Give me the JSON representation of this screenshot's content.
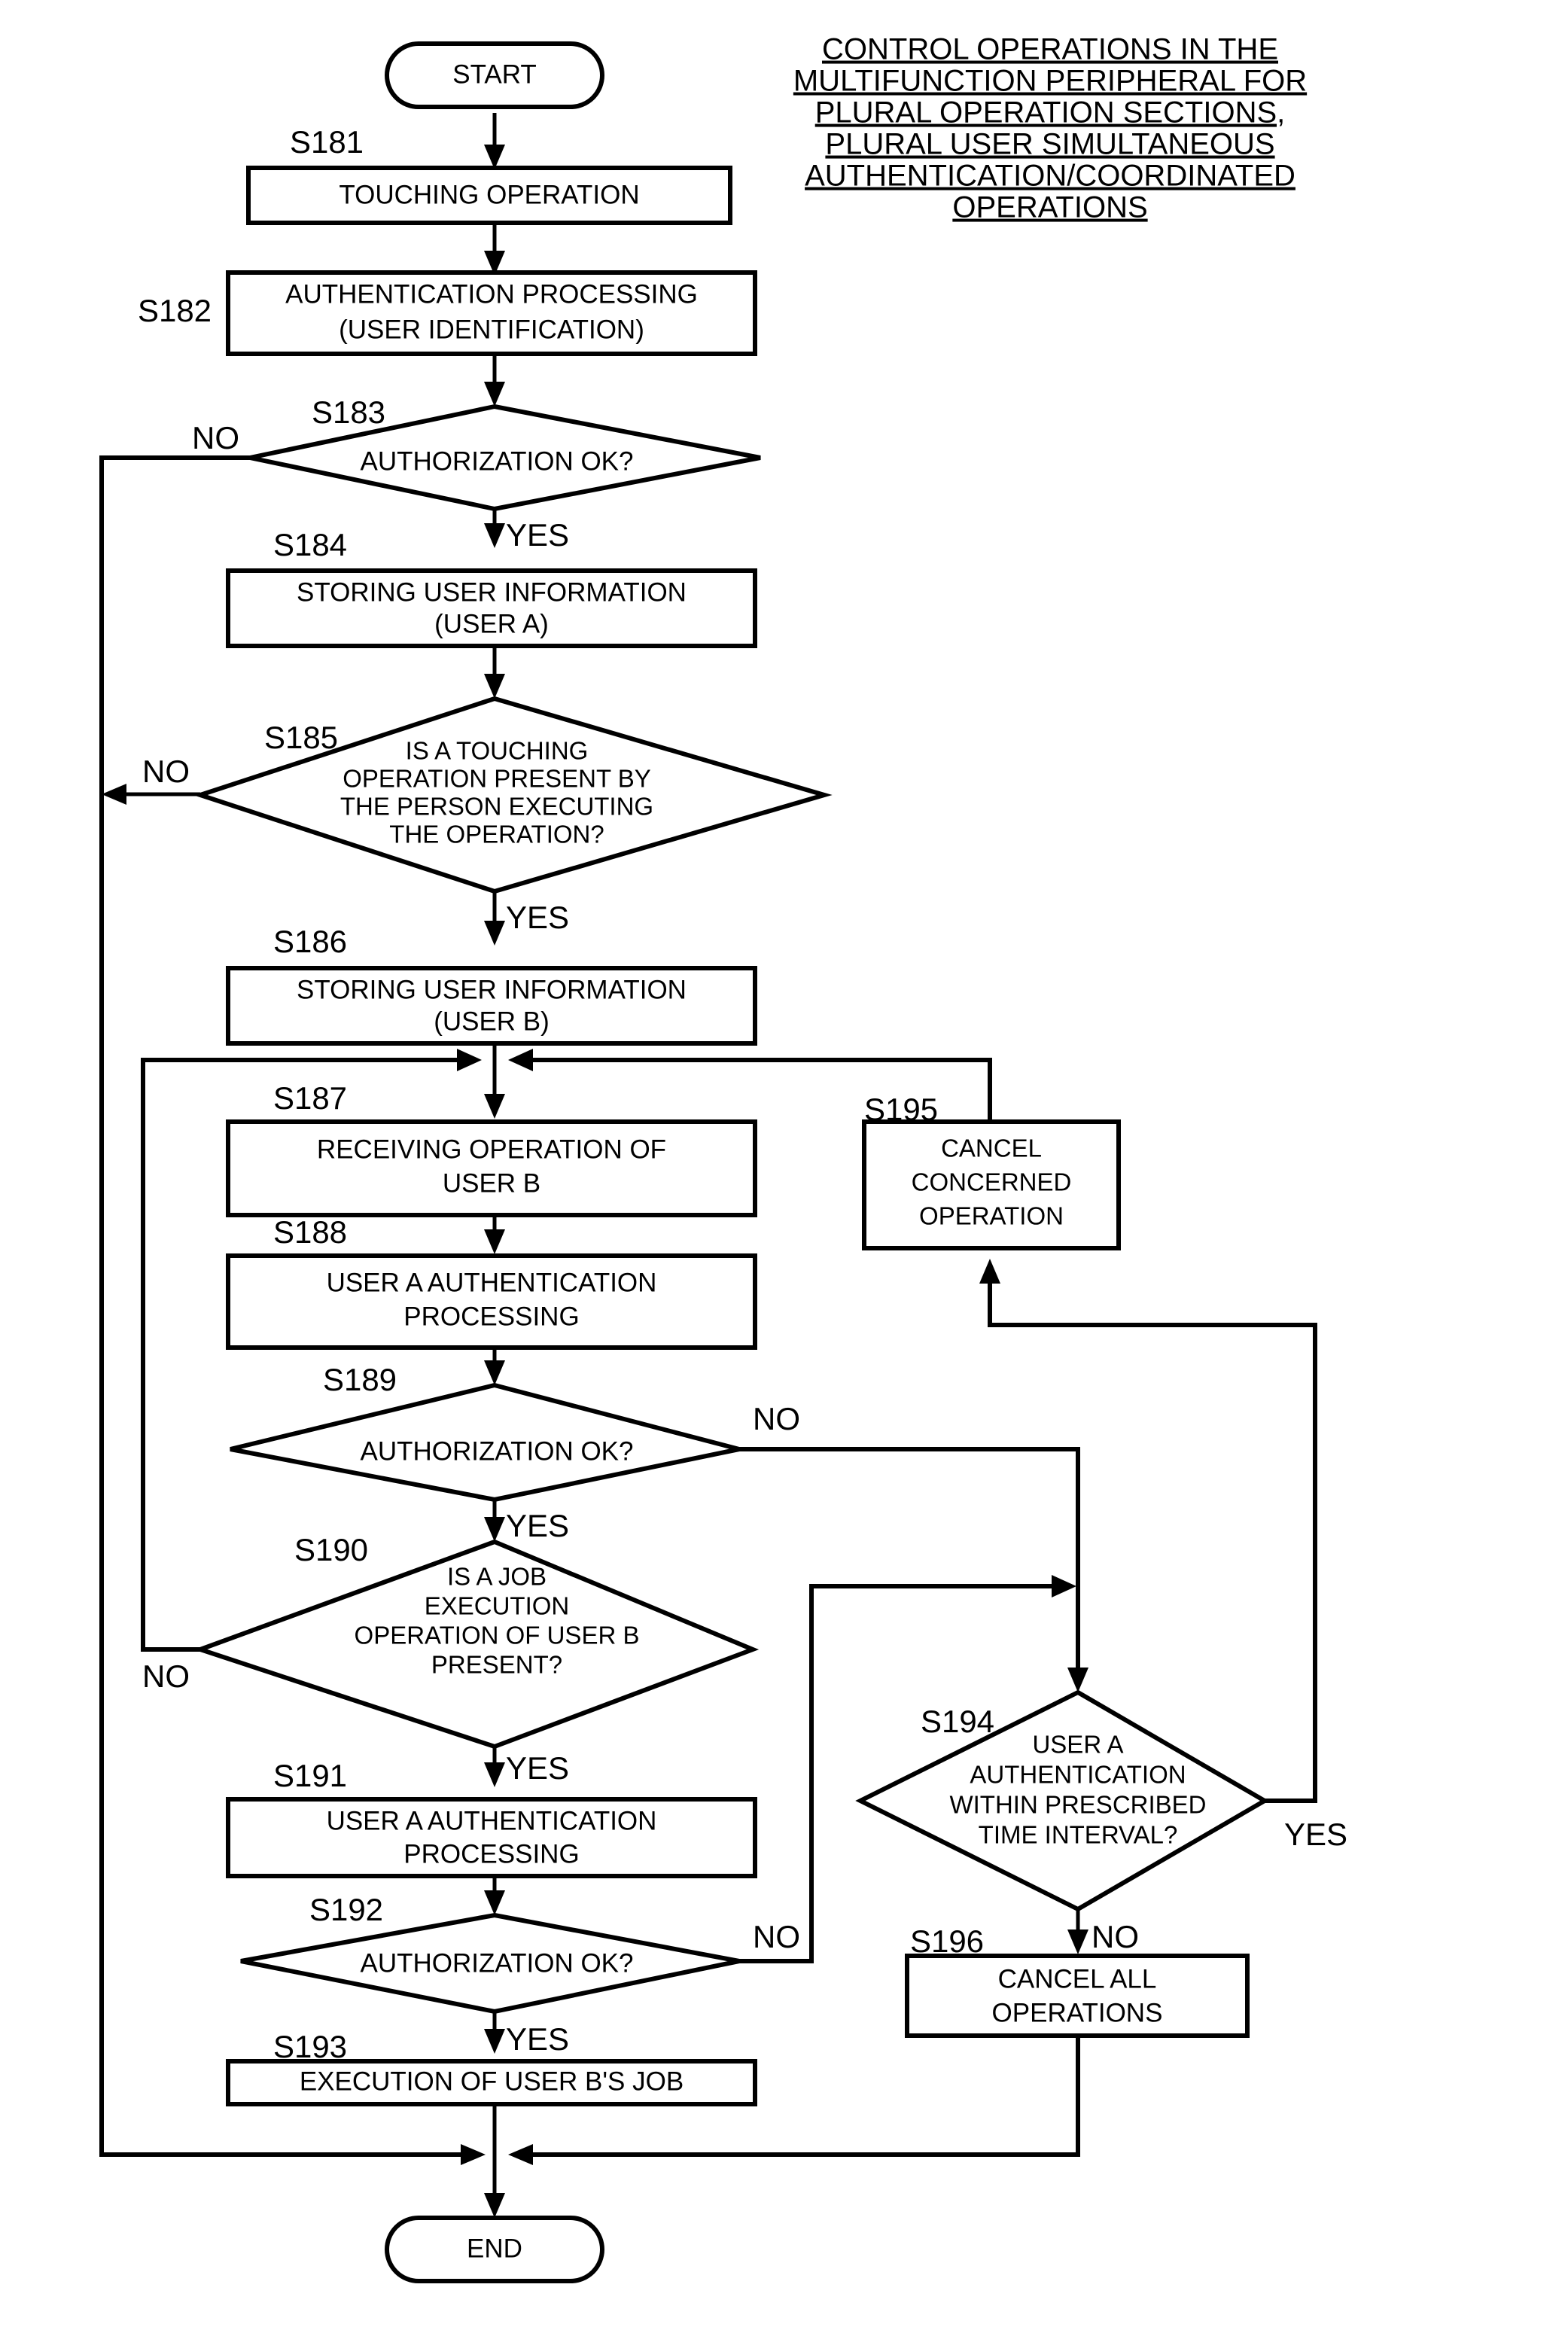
{
  "figure": {
    "title_lines": [
      "CONTROL OPERATIONS IN THE",
      "MULTIFUNCTION PERIPHERAL FOR",
      "PLURAL OPERATION SECTIONS,",
      "PLURAL USER SIMULTANEOUS",
      "AUTHENTICATION/COORDINATED",
      "OPERATIONS"
    ],
    "colors": {
      "stroke": "#000000",
      "fill": "#ffffff",
      "background": "#ffffff"
    }
  },
  "chart_data": {
    "type": "diagram",
    "diagram_type": "flowchart",
    "title": "CONTROL OPERATIONS IN THE MULTIFUNCTION PERIPHERAL FOR PLURAL OPERATION SECTIONS, PLURAL USER SIMULTANEOUS AUTHENTICATION/COORDINATED OPERATIONS",
    "nodes": [
      {
        "id": "start",
        "step": "",
        "shape": "terminator",
        "text": [
          "START"
        ]
      },
      {
        "id": "s181",
        "step": "S181",
        "shape": "process",
        "text": [
          "TOUCHING OPERATION"
        ]
      },
      {
        "id": "s182",
        "step": "S182",
        "shape": "process",
        "text": [
          "AUTHENTICATION PROCESSING",
          "(USER IDENTIFICATION)"
        ]
      },
      {
        "id": "s183",
        "step": "S183",
        "shape": "decision",
        "text": [
          "AUTHORIZATION OK?"
        ]
      },
      {
        "id": "s184",
        "step": "S184",
        "shape": "process",
        "text": [
          "STORING USER INFORMATION",
          "(USER A)"
        ]
      },
      {
        "id": "s185",
        "step": "S185",
        "shape": "decision",
        "text": [
          "IS A TOUCHING",
          "OPERATION PRESENT BY",
          "THE PERSON EXECUTING",
          "THE OPERATION?"
        ]
      },
      {
        "id": "s186",
        "step": "S186",
        "shape": "process",
        "text": [
          "STORING USER INFORMATION",
          "(USER B)"
        ]
      },
      {
        "id": "s187",
        "step": "S187",
        "shape": "process",
        "text": [
          "RECEIVING OPERATION OF",
          "USER B"
        ]
      },
      {
        "id": "s188",
        "step": "S188",
        "shape": "process",
        "text": [
          "USER A AUTHENTICATION",
          "PROCESSING"
        ]
      },
      {
        "id": "s189",
        "step": "S189",
        "shape": "decision",
        "text": [
          "AUTHORIZATION OK?"
        ]
      },
      {
        "id": "s190",
        "step": "S190",
        "shape": "decision",
        "text": [
          "IS A JOB",
          "EXECUTION",
          "OPERATION OF USER B",
          "PRESENT?"
        ]
      },
      {
        "id": "s191",
        "step": "S191",
        "shape": "process",
        "text": [
          "USER A AUTHENTICATION",
          "PROCESSING"
        ]
      },
      {
        "id": "s192",
        "step": "S192",
        "shape": "decision",
        "text": [
          "AUTHORIZATION OK?"
        ]
      },
      {
        "id": "s193",
        "step": "S193",
        "shape": "process",
        "text": [
          "EXECUTION OF USER B'S JOB"
        ]
      },
      {
        "id": "s194",
        "step": "S194",
        "shape": "decision",
        "text": [
          "USER A",
          "AUTHENTICATION",
          "WITHIN PRESCRIBED",
          "TIME INTERVAL?"
        ]
      },
      {
        "id": "s195",
        "step": "S195",
        "shape": "process",
        "text": [
          "CANCEL",
          "CONCERNED",
          "OPERATION"
        ]
      },
      {
        "id": "s196",
        "step": "S196",
        "shape": "process",
        "text": [
          "CANCEL ALL",
          "OPERATIONS"
        ]
      },
      {
        "id": "end",
        "step": "",
        "shape": "terminator",
        "text": [
          "END"
        ]
      }
    ],
    "edges": [
      {
        "from": "start",
        "to": "s181",
        "label": ""
      },
      {
        "from": "s181",
        "to": "s182",
        "label": ""
      },
      {
        "from": "s182",
        "to": "s183",
        "label": ""
      },
      {
        "from": "s183",
        "to": "end",
        "label": "NO"
      },
      {
        "from": "s183",
        "to": "s184",
        "label": "YES"
      },
      {
        "from": "s184",
        "to": "s185",
        "label": ""
      },
      {
        "from": "s185",
        "to": "end",
        "label": "NO"
      },
      {
        "from": "s185",
        "to": "s186",
        "label": "YES"
      },
      {
        "from": "s186",
        "to": "s187",
        "label": ""
      },
      {
        "from": "s187",
        "to": "s188",
        "label": ""
      },
      {
        "from": "s188",
        "to": "s189",
        "label": ""
      },
      {
        "from": "s189",
        "to": "s194",
        "label": "NO"
      },
      {
        "from": "s189",
        "to": "s190",
        "label": "YES"
      },
      {
        "from": "s190",
        "to": "s187",
        "label": "NO"
      },
      {
        "from": "s190",
        "to": "s191",
        "label": "YES"
      },
      {
        "from": "s191",
        "to": "s192",
        "label": ""
      },
      {
        "from": "s192",
        "to": "s194",
        "label": "NO"
      },
      {
        "from": "s192",
        "to": "s193",
        "label": "YES"
      },
      {
        "from": "s193",
        "to": "end",
        "label": ""
      },
      {
        "from": "s194",
        "to": "s195",
        "label": "YES"
      },
      {
        "from": "s194",
        "to": "s196",
        "label": "NO"
      },
      {
        "from": "s195",
        "to": "s187",
        "label": ""
      },
      {
        "from": "s196",
        "to": "end",
        "label": ""
      }
    ],
    "edge_labels": [
      "YES",
      "NO"
    ]
  },
  "nodes": {
    "start": {
      "step": "",
      "l1": "START",
      "l2": "",
      "l3": "",
      "l4": ""
    },
    "s181": {
      "step": "S181",
      "l1": "TOUCHING OPERATION",
      "l2": "",
      "l3": "",
      "l4": ""
    },
    "s182": {
      "step": "S182",
      "l1": "AUTHENTICATION PROCESSING",
      "l2": "(USER IDENTIFICATION)",
      "l3": "",
      "l4": ""
    },
    "s183": {
      "step": "S183",
      "l1": "AUTHORIZATION OK?",
      "l2": "",
      "l3": "",
      "l4": ""
    },
    "s184": {
      "step": "S184",
      "l1": "STORING USER INFORMATION",
      "l2": "(USER A)",
      "l3": "",
      "l4": ""
    },
    "s185": {
      "step": "S185",
      "l1": "IS A TOUCHING",
      "l2": "OPERATION PRESENT BY",
      "l3": "THE PERSON EXECUTING",
      "l4": "THE OPERATION?"
    },
    "s186": {
      "step": "S186",
      "l1": "STORING USER INFORMATION",
      "l2": "(USER B)",
      "l3": "",
      "l4": ""
    },
    "s187": {
      "step": "S187",
      "l1": "RECEIVING OPERATION OF",
      "l2": "USER B",
      "l3": "",
      "l4": ""
    },
    "s188": {
      "step": "S188",
      "l1": "USER A AUTHENTICATION",
      "l2": "PROCESSING",
      "l3": "",
      "l4": ""
    },
    "s189": {
      "step": "S189",
      "l1": "AUTHORIZATION OK?",
      "l2": "",
      "l3": "",
      "l4": ""
    },
    "s190": {
      "step": "S190",
      "l1": "IS A JOB",
      "l2": "EXECUTION",
      "l3": "OPERATION OF USER B",
      "l4": "PRESENT?"
    },
    "s191": {
      "step": "S191",
      "l1": "USER A AUTHENTICATION",
      "l2": "PROCESSING",
      "l3": "",
      "l4": ""
    },
    "s192": {
      "step": "S192",
      "l1": "AUTHORIZATION OK?",
      "l2": "",
      "l3": "",
      "l4": ""
    },
    "s193": {
      "step": "S193",
      "l1": "EXECUTION OF USER B'S JOB",
      "l2": "",
      "l3": "",
      "l4": ""
    },
    "s194": {
      "step": "S194",
      "l1": "USER A",
      "l2": "AUTHENTICATION",
      "l3": "WITHIN PRESCRIBED",
      "l4": "TIME INTERVAL?"
    },
    "s195": {
      "step": "S195",
      "l1": "CANCEL",
      "l2": "CONCERNED",
      "l3": "OPERATION",
      "l4": ""
    },
    "s196": {
      "step": "S196",
      "l1": "CANCEL ALL",
      "l2": "OPERATIONS",
      "l3": "",
      "l4": ""
    },
    "end": {
      "step": "",
      "l1": "END",
      "l2": "",
      "l3": "",
      "l4": ""
    }
  },
  "labels": {
    "no_s183": "NO",
    "yes_s183": "YES",
    "no_s185": "NO",
    "yes_s185": "YES",
    "no_s189": "NO",
    "yes_s189": "YES",
    "no_s190": "NO",
    "yes_s190": "YES",
    "no_s192": "NO",
    "yes_s192": "YES",
    "yes_s194": "YES",
    "no_s194": "NO"
  },
  "title": {
    "line1": "CONTROL OPERATIONS IN THE",
    "line2": "MULTIFUNCTION PERIPHERAL FOR",
    "line3": "PLURAL OPERATION SECTIONS,",
    "line4": "PLURAL USER SIMULTANEOUS",
    "line5": "AUTHENTICATION/COORDINATED",
    "line6": "OPERATIONS"
  }
}
